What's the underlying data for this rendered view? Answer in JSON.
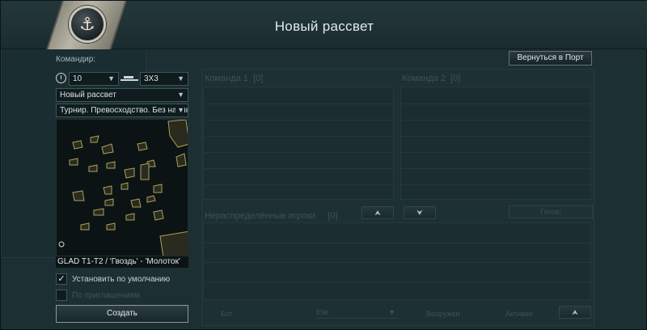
{
  "window": {
    "title": "Новый рассвет"
  },
  "header": {
    "commander_label": "Командир:",
    "back_to_port": "Вернуться в Порт"
  },
  "settings": {
    "time_value": "10",
    "mode_value": "3X3",
    "map_value": "Новый рассвет",
    "scenario_value": "Турнир. Превосходство. Без наблюда",
    "map_caption": "GLAD T1-T2 / 'Гвоздь' -  'Молоток'",
    "default_checkbox": {
      "label": "Установить по умолчанию",
      "checked": true
    },
    "invite_checkbox": {
      "label": "По приглашениям",
      "checked": false
    },
    "create_button": "Создать"
  },
  "teams": {
    "team1": {
      "label": "Команда 1",
      "count": "[0]"
    },
    "team2": {
      "label": "Команда 2",
      "count": "[0]"
    },
    "unassigned": {
      "label": "Нераспределённые игроки",
      "count": "[0]"
    },
    "up_button": "⮝",
    "down_button": "⮟",
    "gray_button": "Готов!"
  },
  "footer": {
    "bot_label": "Бот",
    "type_select": "Elle",
    "armed_label": "Вооружён",
    "active_label": "Активен",
    "up_button": "⮝"
  },
  "colors": {
    "accent": "#8f9a92",
    "background": "#1c2f33"
  }
}
